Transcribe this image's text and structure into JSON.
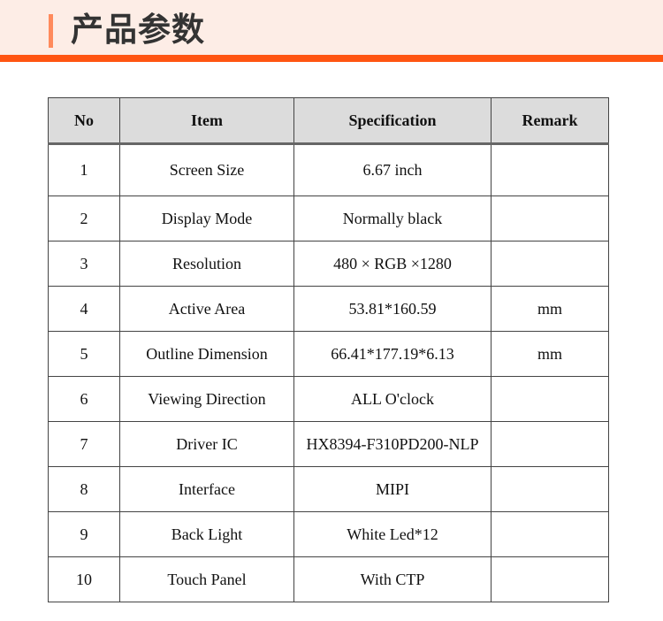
{
  "header": {
    "title": "产品参数",
    "accent_color": "#ff5512",
    "bar_color": "#ff8a5c",
    "background_color": "#fdede6"
  },
  "table": {
    "columns": [
      "No",
      "Item",
      "Specification",
      "Remark"
    ],
    "rows": [
      {
        "no": "1",
        "item": "Screen Size",
        "spec": "6.67 inch",
        "remark": ""
      },
      {
        "no": "2",
        "item": "Display Mode",
        "spec": "Normally black",
        "remark": ""
      },
      {
        "no": "3",
        "item": "Resolution",
        "spec": "480 × RGB ×1280",
        "remark": ""
      },
      {
        "no": "4",
        "item": "Active Area",
        "spec": "53.81*160.59",
        "remark": "mm"
      },
      {
        "no": "5",
        "item": "Outline Dimension",
        "spec": "66.41*177.19*6.13",
        "remark": "mm"
      },
      {
        "no": "6",
        "item": "Viewing Direction",
        "spec": "ALL O'clock",
        "remark": ""
      },
      {
        "no": "7",
        "item": "Driver IC",
        "spec": "HX8394-F310PD200-NLP",
        "remark": ""
      },
      {
        "no": "8",
        "item": "Interface",
        "spec": "MIPI",
        "remark": ""
      },
      {
        "no": "9",
        "item": "Back Light",
        "spec": "White Led*12",
        "remark": ""
      },
      {
        "no": "10",
        "item": "Touch Panel",
        "spec": "With CTP",
        "remark": ""
      }
    ]
  }
}
